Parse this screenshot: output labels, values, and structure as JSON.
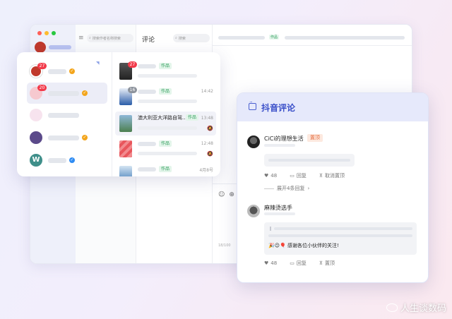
{
  "back_window": {
    "search_placeholder": "搜索作者名称搜索",
    "column_title": "评论",
    "column_search_placeholder": "搜索",
    "main_tag": "作品",
    "emoji_icons": [
      "☺",
      "⊕"
    ],
    "char_counter": "18/100",
    "dot_colors": [
      "#ff5f57",
      "#febc2e",
      "#28c840"
    ]
  },
  "accounts": [
    {
      "badge": "27",
      "avatar_color": "#c0392b",
      "verify": "gold",
      "active": false
    },
    {
      "badge": "20",
      "avatar_color": "#f6c9cf",
      "verify": "gold",
      "active": true
    },
    {
      "badge": "",
      "avatar_color": "#f7e3ee",
      "verify": "",
      "active": false
    },
    {
      "badge": "",
      "avatar_color": "#5b4a8a",
      "verify": "gold",
      "active": false
    },
    {
      "badge": "",
      "avatar_color": "#3f8f8a",
      "verify": "blue",
      "active": false,
      "avatar_letter": "W"
    }
  ],
  "feed": [
    {
      "badge": "27",
      "badge_type": "red",
      "tag": "作品",
      "title": "",
      "time": "",
      "mute": false,
      "thumb_color": "#3a3a3a"
    },
    {
      "badge": "16",
      "badge_type": "gray",
      "tag": "作品",
      "title": "",
      "time": "14:42",
      "mute": false,
      "thumb_color": "#2a5da8"
    },
    {
      "badge": "",
      "badge_type": "",
      "tag": "作品",
      "title": "澳大利亚大洋路自驾...",
      "time": "13:48",
      "mute": true,
      "thumb_color": "#4c7f4f"
    },
    {
      "badge": "",
      "badge_type": "",
      "tag": "作品",
      "title": "",
      "time": "12:48",
      "mute": true,
      "thumb_color": "#e8565c"
    },
    {
      "badge": "",
      "badge_type": "",
      "tag": "作品",
      "title": "",
      "time": "4月8号",
      "mute": false,
      "thumb_color": "#3b79b6"
    }
  ],
  "comment_panel": {
    "title": "抖音评论",
    "comments": [
      {
        "name": "CiCi的理想生活",
        "pinned_label": "置顶",
        "likes": "48",
        "reply_label": "回复",
        "pin_action": "取消置顶",
        "expand_label": "展开4条回复"
      },
      {
        "name": "麻辣烫选手",
        "reply_text": "🎉😉🎈 感谢各位小伙伴的关注!",
        "likes": "48",
        "reply_label": "回复",
        "pin_action": "置顶"
      }
    ]
  },
  "watermark": "人生谈数码"
}
